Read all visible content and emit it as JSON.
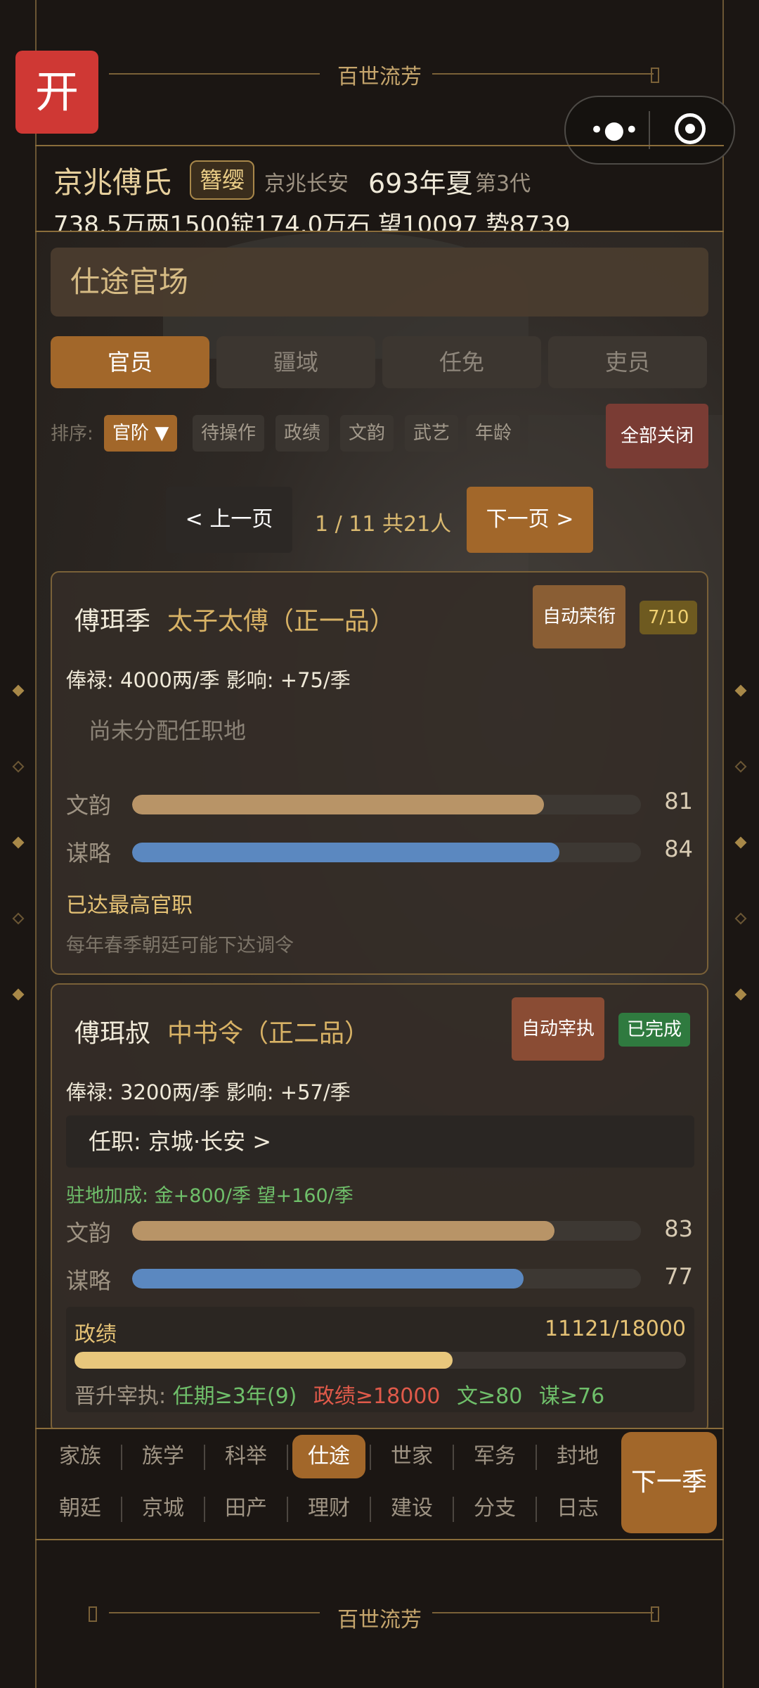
{
  "header": {
    "banner_title": "百世流芳",
    "open_button": "开",
    "family_name": "京兆傅氏",
    "rank_badge": "簪缨",
    "location": "京兆长安",
    "year_season": "693年夏",
    "generation": "第3代",
    "resources": "738.5万两1500锭174.0万石  望10097 势8739"
  },
  "section": {
    "title": "仕途官场",
    "tabs": [
      "官员",
      "疆域",
      "任免",
      "吏员"
    ],
    "active_tab": 0
  },
  "sort": {
    "label": "排序:",
    "chips": [
      "官阶 ▼",
      "待操作",
      "政绩",
      "文韵",
      "武艺",
      "年龄"
    ],
    "close_all": "全部关闭"
  },
  "pager": {
    "prev": "< 上一页",
    "info": "1 / 11  共21人",
    "next": "下一页 >"
  },
  "officials": [
    {
      "name": "傅珥季",
      "rank": "太子太傅（正一品）",
      "auto_button": "自动荣衔",
      "status": "7/10",
      "salary": "俸禄: 4000两/季   影响: +75/季",
      "post": "尚未分配任职地",
      "attrs": [
        {
          "label": "文韵",
          "value": 81,
          "color": "#b89467"
        },
        {
          "label": "谋略",
          "value": 84,
          "color": "#5b88c0"
        }
      ],
      "top_rank": "已达最高官职",
      "hint": "每年春季朝廷可能下达调令"
    },
    {
      "name": "傅珥叔",
      "rank": "中书令（正二品）",
      "auto_button": "自动宰执",
      "status": "已完成",
      "salary": "俸禄: 3200两/季   影响: +57/季",
      "post": "任职: 京城·长安  >",
      "bonus": "驻地加成: 金+800/季  望+160/季",
      "attrs": [
        {
          "label": "文韵",
          "value": 83,
          "color": "#b89467"
        },
        {
          "label": "谋略",
          "value": 77,
          "color": "#5b88c0"
        }
      ],
      "merit": {
        "label": "政绩",
        "value_text": "11121/18000",
        "value": 11121,
        "max": 18000
      },
      "requirements": {
        "prefix": "晋升宰执: ",
        "items": [
          {
            "text": "任期≥3年(9)",
            "met": true
          },
          {
            "text": "政绩≥18000",
            "met": false
          },
          {
            "text": "文≥80",
            "met": true
          },
          {
            "text": "谋≥76",
            "met": true
          }
        ]
      }
    }
  ],
  "nav": {
    "row1": [
      "家族",
      "族学",
      "科举",
      "仕途",
      "世家",
      "军务",
      "封地"
    ],
    "row2": [
      "朝廷",
      "京城",
      "田产",
      "理财",
      "建设",
      "分支",
      "日志"
    ],
    "active": "仕途",
    "next_season": "下一季"
  },
  "footer": {
    "banner_title": "百世流芳"
  },
  "colors": {
    "accent": "#a2672a",
    "gold": "#d8b265",
    "met": "#6fbf6a",
    "unmet": "#e05a4a"
  }
}
